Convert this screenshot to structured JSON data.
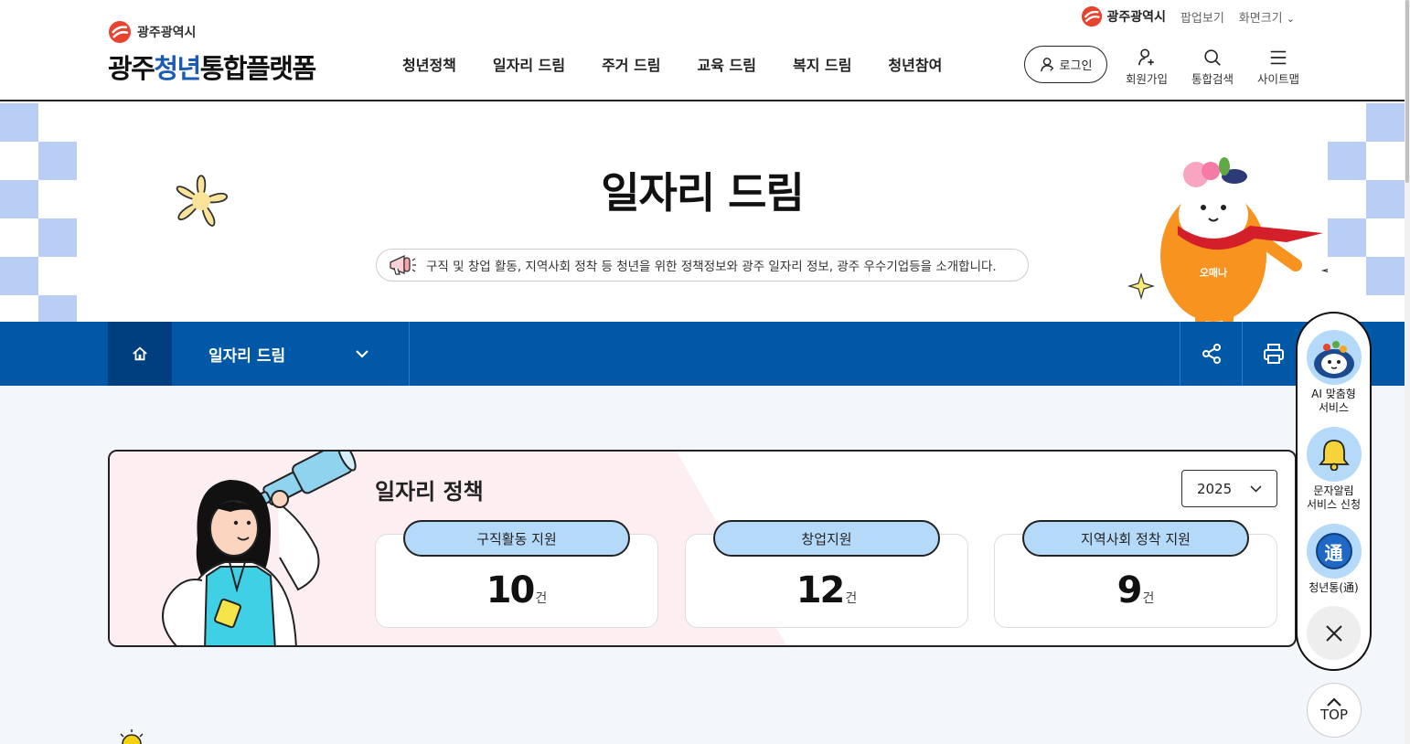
{
  "header": {
    "org_small": "광주광역시",
    "logo_prefix": "광주",
    "logo_accent": "청년",
    "logo_suffix": "통합플랫폼",
    "nav": [
      "청년정책",
      "일자리 드림",
      "주거 드림",
      "교육 드림",
      "복지 드림",
      "청년참여"
    ],
    "top_util": {
      "city": "광주광역시",
      "popup": "팝업보기",
      "zoom": "화면크기"
    },
    "login": "로그인",
    "utils": [
      {
        "label": "회원가입",
        "icon": "user-add-icon"
      },
      {
        "label": "통합검색",
        "icon": "search-icon"
      },
      {
        "label": "사이트맵",
        "icon": "menu-icon"
      }
    ]
  },
  "banner": {
    "title": "일자리 드림",
    "description": "구직 및 창업 활동, 지역사회 정착 등 청년을 위한 정책정보와 광주 일자리 정보, 광주 우수기업등을 소개합니다.",
    "mascot_name": "오매나"
  },
  "location": {
    "current": "일자리 드림"
  },
  "policy": {
    "title": "일자리 정책",
    "year": "2025",
    "stats": [
      {
        "label": "구직활동 지원",
        "value": "10",
        "unit": "건"
      },
      {
        "label": "창업지원",
        "value": "12",
        "unit": "건"
      },
      {
        "label": "지역사회 정착 지원",
        "value": "9",
        "unit": "건"
      }
    ]
  },
  "quick_menu": {
    "items": [
      {
        "label": "AI 맞춤형\n서비스",
        "icon": "ai-mascot-icon"
      },
      {
        "label": "문자알림\n서비스 신청",
        "icon": "bell-icon"
      },
      {
        "label": "청년통(通)",
        "icon": "tong-icon",
        "glyph": "通"
      }
    ],
    "top": "TOP"
  },
  "colors": {
    "primary": "#0058a6",
    "primary_dark": "#003f7f",
    "accent_light": "#b5daf9",
    "check": "#b8cef5",
    "logo_blue": "#1a5cb3"
  }
}
